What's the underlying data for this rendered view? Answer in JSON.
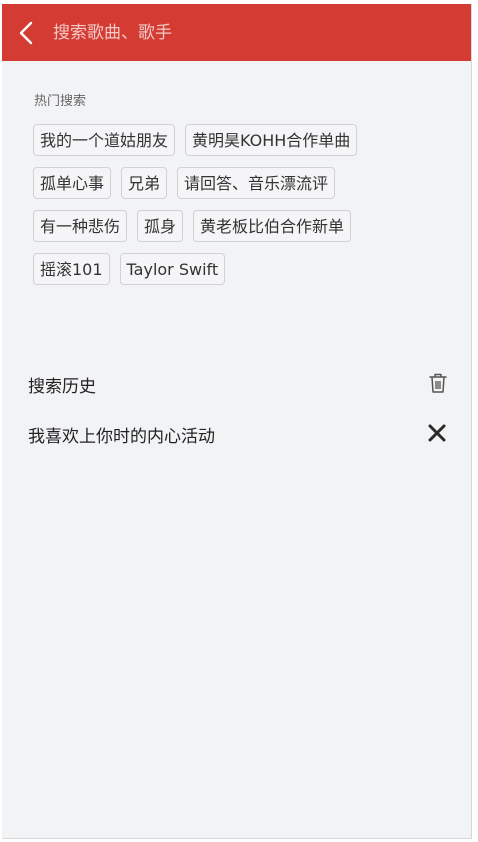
{
  "header": {
    "search_placeholder": "搜索歌曲、歌手",
    "back_icon": "chevron-left-icon",
    "background_color": "#d43c33"
  },
  "hot_search": {
    "title": "热门搜索",
    "tags": [
      "我的一个道姑朋友",
      "黄明昊KOHH合作单曲",
      "孤单心事",
      "兄弟",
      "请回答、音乐漂流评",
      "有一种悲伤",
      "孤身",
      "黄老板比伯合作新单",
      "摇滚101",
      "Taylor Swift"
    ]
  },
  "history": {
    "title": "搜索历史",
    "clear_icon": "trash-icon",
    "items": [
      {
        "text": "我喜欢上你时的内心活动",
        "remove_icon": "close-icon"
      }
    ]
  }
}
